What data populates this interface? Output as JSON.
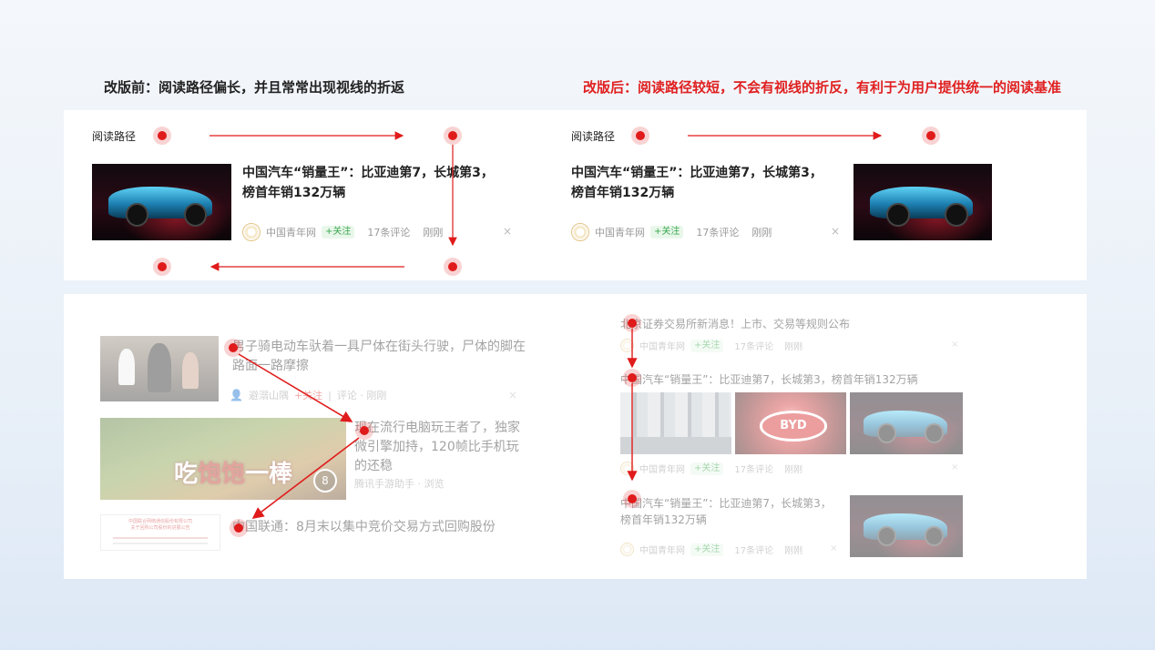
{
  "headings": {
    "before": "改版前：阅读路径偏长，并且常常出现视线的折返",
    "after": "改版后：阅读路径较短，不会有视线的折反，有利于为用户提供统一的阅读基准"
  },
  "top_panel": {
    "path_label": "阅读路径",
    "article": {
      "title_line1": "中国汽车“销量王”：比亚迪第7，长城第3，",
      "title_line2": "榜首年销132万辆",
      "source": "中国青年网",
      "follow": "+关注",
      "comments": "17条评论",
      "time": "刚刚",
      "close": "×"
    }
  },
  "bottom_left": {
    "item1": {
      "title_line1": "男子骑电动车驮着一具尸体在街头行驶，尸体的脚在",
      "title_line2": "路面一路摩擦",
      "source": "避溺山隅",
      "follow": "+关注",
      "meta": "评论 · 刚刚",
      "close": "×"
    },
    "item2": {
      "title_line1": "现在流行电脑玩王者了，独家",
      "title_line2": "微引擎加持，120帧比手机玩",
      "title_line3": "的还稳",
      "source": "腾讯手游助手 · 浏览",
      "image_text_a": "吃",
      "image_text_b": "饱饱",
      "image_text_c": "一棒",
      "pager": "8"
    },
    "item3": {
      "title": "中国联通：8月末以集中竞价交易方式回购股份",
      "doc_line1": "中国联合网络通信股份有限公司",
      "doc_line2": "关于回购公司股份的进展公告"
    }
  },
  "bottom_right": {
    "item1": {
      "title": "北京证券交易所新消息！上市、交易等规则公布",
      "source": "中国青年网",
      "follow": "+关注",
      "comments": "17条评论",
      "time": "刚刚",
      "close": "×"
    },
    "item2": {
      "title": "中国汽车“销量王”：比亚迪第7，长城第3，榜首年销132万辆",
      "source": "中国青年网",
      "follow": "+关注",
      "comments": "17条评论",
      "time": "刚刚",
      "close": "×",
      "byd_sign": "BYD"
    },
    "item3": {
      "title_line1": "中国汽车“销量王”：比亚迪第7，长城第3，",
      "title_line2": "榜首年销132万辆",
      "source": "中国青年网",
      "follow": "+关注",
      "comments": "17条评论",
      "time": "刚刚",
      "close": "×"
    }
  },
  "colors": {
    "accent_red": "#e01b1b",
    "follow_green": "#3ba84f",
    "heading_after": "#e02020"
  }
}
